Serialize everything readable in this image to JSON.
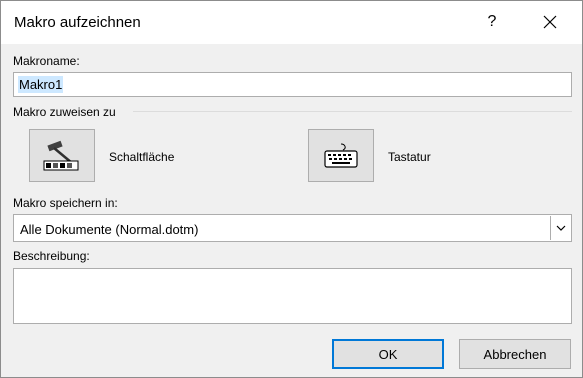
{
  "window": {
    "title": "Makro aufzeichnen",
    "help_label": "?"
  },
  "macro_name": {
    "label": "Makroname:",
    "value": "Makro1"
  },
  "assign": {
    "label": "Makro zuweisen zu",
    "button_label": "Schaltfläche",
    "keyboard_label": "Tastatur"
  },
  "store_in": {
    "label": "Makro speichern in:",
    "selected": "Alle Dokumente (Normal.dotm)"
  },
  "description": {
    "label": "Beschreibung:",
    "value": ""
  },
  "buttons": {
    "ok": "OK",
    "cancel": "Abbrechen"
  },
  "icons": {
    "close": "close-icon",
    "button_assign": "hammer-toolbar-icon",
    "keyboard_assign": "keyboard-icon",
    "dropdown": "chevron-down-icon"
  },
  "colors": {
    "dialog_bg": "#f0f0f0",
    "selection": "#cde8ff",
    "default_button_border": "#0078d7"
  }
}
